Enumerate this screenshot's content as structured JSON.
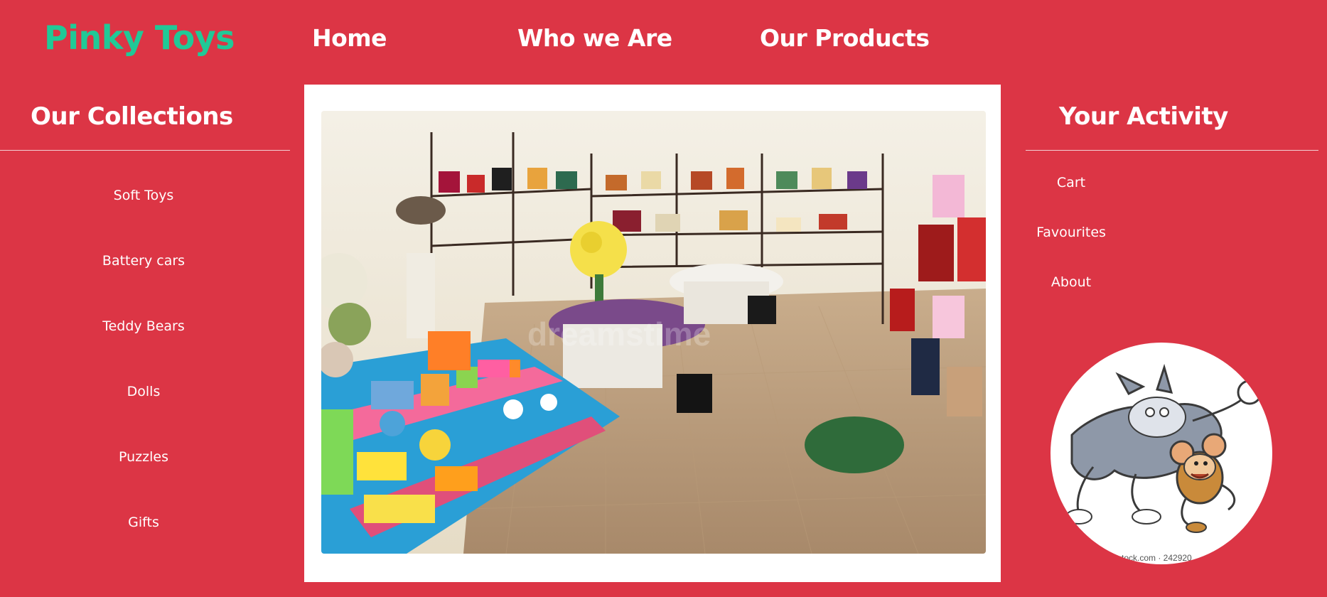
{
  "brand": {
    "name": "Pinky Toys"
  },
  "nav": {
    "items": [
      "Home",
      "Who we Are",
      "Our Products"
    ]
  },
  "collections": {
    "title": "Our Collections",
    "items": [
      "Soft Toys",
      "Battery cars",
      "Teddy Bears",
      "Dolls",
      "Puzzles",
      "Gifts"
    ]
  },
  "main": {
    "image_watermark": "dreamstime"
  },
  "activity": {
    "title": "Your Activity",
    "items": [
      "Cart",
      "Favourites",
      "About"
    ],
    "avatar_caption": "stock.com · 242920"
  },
  "colors": {
    "background": "#dc3545",
    "brand": "#20c997",
    "panel": "#ffffff"
  }
}
